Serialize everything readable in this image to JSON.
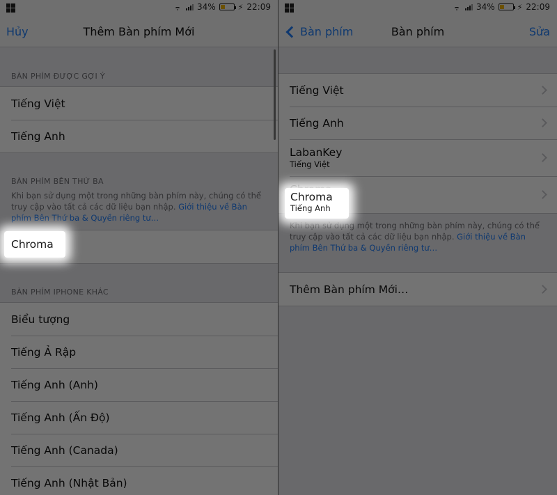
{
  "status": {
    "battery": "34%",
    "time": "22:09",
    "battery_level": 0.34
  },
  "left": {
    "nav": {
      "cancel": "Hủy",
      "title": "Thêm Bàn phím Mới"
    },
    "suggested_header": "BÀN PHÍM ĐƯỢC GỢI Ý",
    "suggested": [
      "Tiếng Việt",
      "Tiếng Anh"
    ],
    "third_party_header": "BÀN PHÍM BÊN THỨ BA",
    "third_party_footer_text": "Khi bạn sử dụng một trong những bàn phím này, chúng có thể truy cập vào tất cả các dữ liệu bạn nhập.",
    "third_party_footer_link": "Giới thiệu về Bàn phím Bên Thứ ba & Quyền riêng tư…",
    "third_party": [
      "Chroma"
    ],
    "other_header": "BÀN PHÍM IPHONE KHÁC",
    "other": [
      "Biểu tượng",
      "Tiếng Ả Rập",
      "Tiếng Anh (Anh)",
      "Tiếng Anh (Ấn Độ)",
      "Tiếng Anh (Canada)",
      "Tiếng Anh (Nhật Bản)"
    ]
  },
  "right": {
    "nav": {
      "back": "Bàn phím",
      "title": "Bàn phím",
      "edit": "Sửa"
    },
    "keyboards": [
      {
        "title": "Tiếng Việt",
        "sub": ""
      },
      {
        "title": "Tiếng Anh",
        "sub": ""
      },
      {
        "title": "LabanKey",
        "sub": "Tiếng Việt"
      },
      {
        "title": "Chroma",
        "sub": "Tiếng Anh"
      }
    ],
    "footer_text": "Khi bạn sử dụng một trong những bàn phím này, chúng có thể truy cập vào tất cả các dữ liệu bạn nhập.",
    "footer_link": "Giới thiệu về Bàn phím Bên Thứ ba & Quyền riêng tư…",
    "add_new": "Thêm Bàn phím Mới…"
  }
}
